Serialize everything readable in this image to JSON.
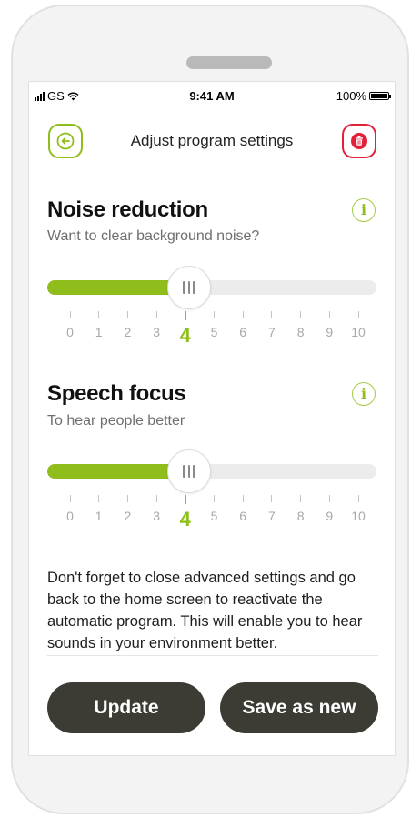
{
  "status_bar": {
    "carrier": "GS",
    "time": "9:41 AM",
    "battery": "100%"
  },
  "header": {
    "title": "Adjust program settings",
    "back_icon": "arrow-left-icon",
    "delete_icon": "trash-icon"
  },
  "sections": [
    {
      "title": "Noise reduction",
      "subtitle": "Want to clear background noise?",
      "info_label": "i",
      "slider": {
        "min": 0,
        "max": 10,
        "value": 4
      }
    },
    {
      "title": "Speech focus",
      "subtitle": "To hear people better",
      "info_label": "i",
      "slider": {
        "min": 0,
        "max": 10,
        "value": 4
      }
    }
  ],
  "notice": "Don't forget to close advanced settings and go back to the home screen to reactivate the automatic program. This will enable you to hear sounds in your environment better.",
  "buttons": {
    "update": "Update",
    "save_as_new": "Save as new"
  },
  "colors": {
    "accent": "#8fbe1c",
    "danger": "#e3213a",
    "button": "#3c3c34"
  }
}
